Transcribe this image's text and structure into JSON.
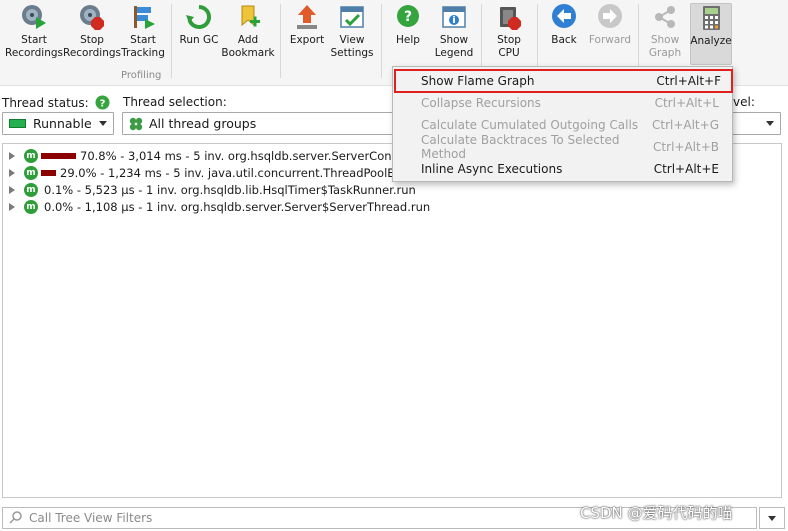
{
  "toolbar": {
    "start_recordings": "Start\nRecordings",
    "stop_recordings": "Stop\nRecordings",
    "start_tracking": "Start\nTracking",
    "run_gc": "Run GC",
    "add_bookmark": "Add\nBookmark",
    "export": "Export",
    "view_settings": "View\nSettings",
    "help": "Help",
    "show_legend": "Show\nLegend",
    "stop_cpu": "Stop\nCPU",
    "back": "Back",
    "forward": "Forward",
    "show_graph": "Show\nGraph",
    "analyze": "Analyze",
    "group_profiling": "Profiling"
  },
  "selection": {
    "thread_status_label": "Thread status:",
    "thread_status_value": "Runnable",
    "thread_selection_label": "Thread selection:",
    "thread_selection_value": "All thread groups",
    "partial_label": "vel:"
  },
  "tree": {
    "rows": [
      {
        "text": "70.8% - 3,014 ms - 5 inv. org.hsqldb.server.ServerConnection",
        "pct": 70.8
      },
      {
        "text": "29.0% - 1,234 ms - 5 inv. java.util.concurrent.ThreadPoolExecuto",
        "pct": 29.0
      },
      {
        "text": "0.1% - 5,523 µs - 1 inv. org.hsqldb.lib.HsqlTimer$TaskRunner.run",
        "pct": 0.1
      },
      {
        "text": "0.0% - 1,108 µs - 1 inv. org.hsqldb.server.Server$ServerThread.run",
        "pct": 0.0
      }
    ],
    "icon_letter": "m"
  },
  "filter": {
    "placeholder": "Call Tree View Filters"
  },
  "watermark": "CSDN @爱码代码的喵",
  "menu": {
    "items": [
      {
        "label": "Show Flame Graph",
        "shortcut": "Ctrl+Alt+F"
      },
      {
        "label": "Collapse Recursions",
        "shortcut": "Ctrl+Alt+L"
      },
      {
        "label": "Calculate Cumulated Outgoing Calls",
        "shortcut": "Ctrl+Alt+G"
      },
      {
        "label": "Calculate Backtraces To Selected Method",
        "shortcut": "Ctrl+Alt+B"
      },
      {
        "label": "Inline Async Executions",
        "shortcut": "Ctrl+Alt+E"
      }
    ]
  },
  "colors": {
    "bar": "#8b0000",
    "highlight": "#e0201e",
    "method_icon": "#2f9e3a",
    "runnable": "#22b14c"
  }
}
